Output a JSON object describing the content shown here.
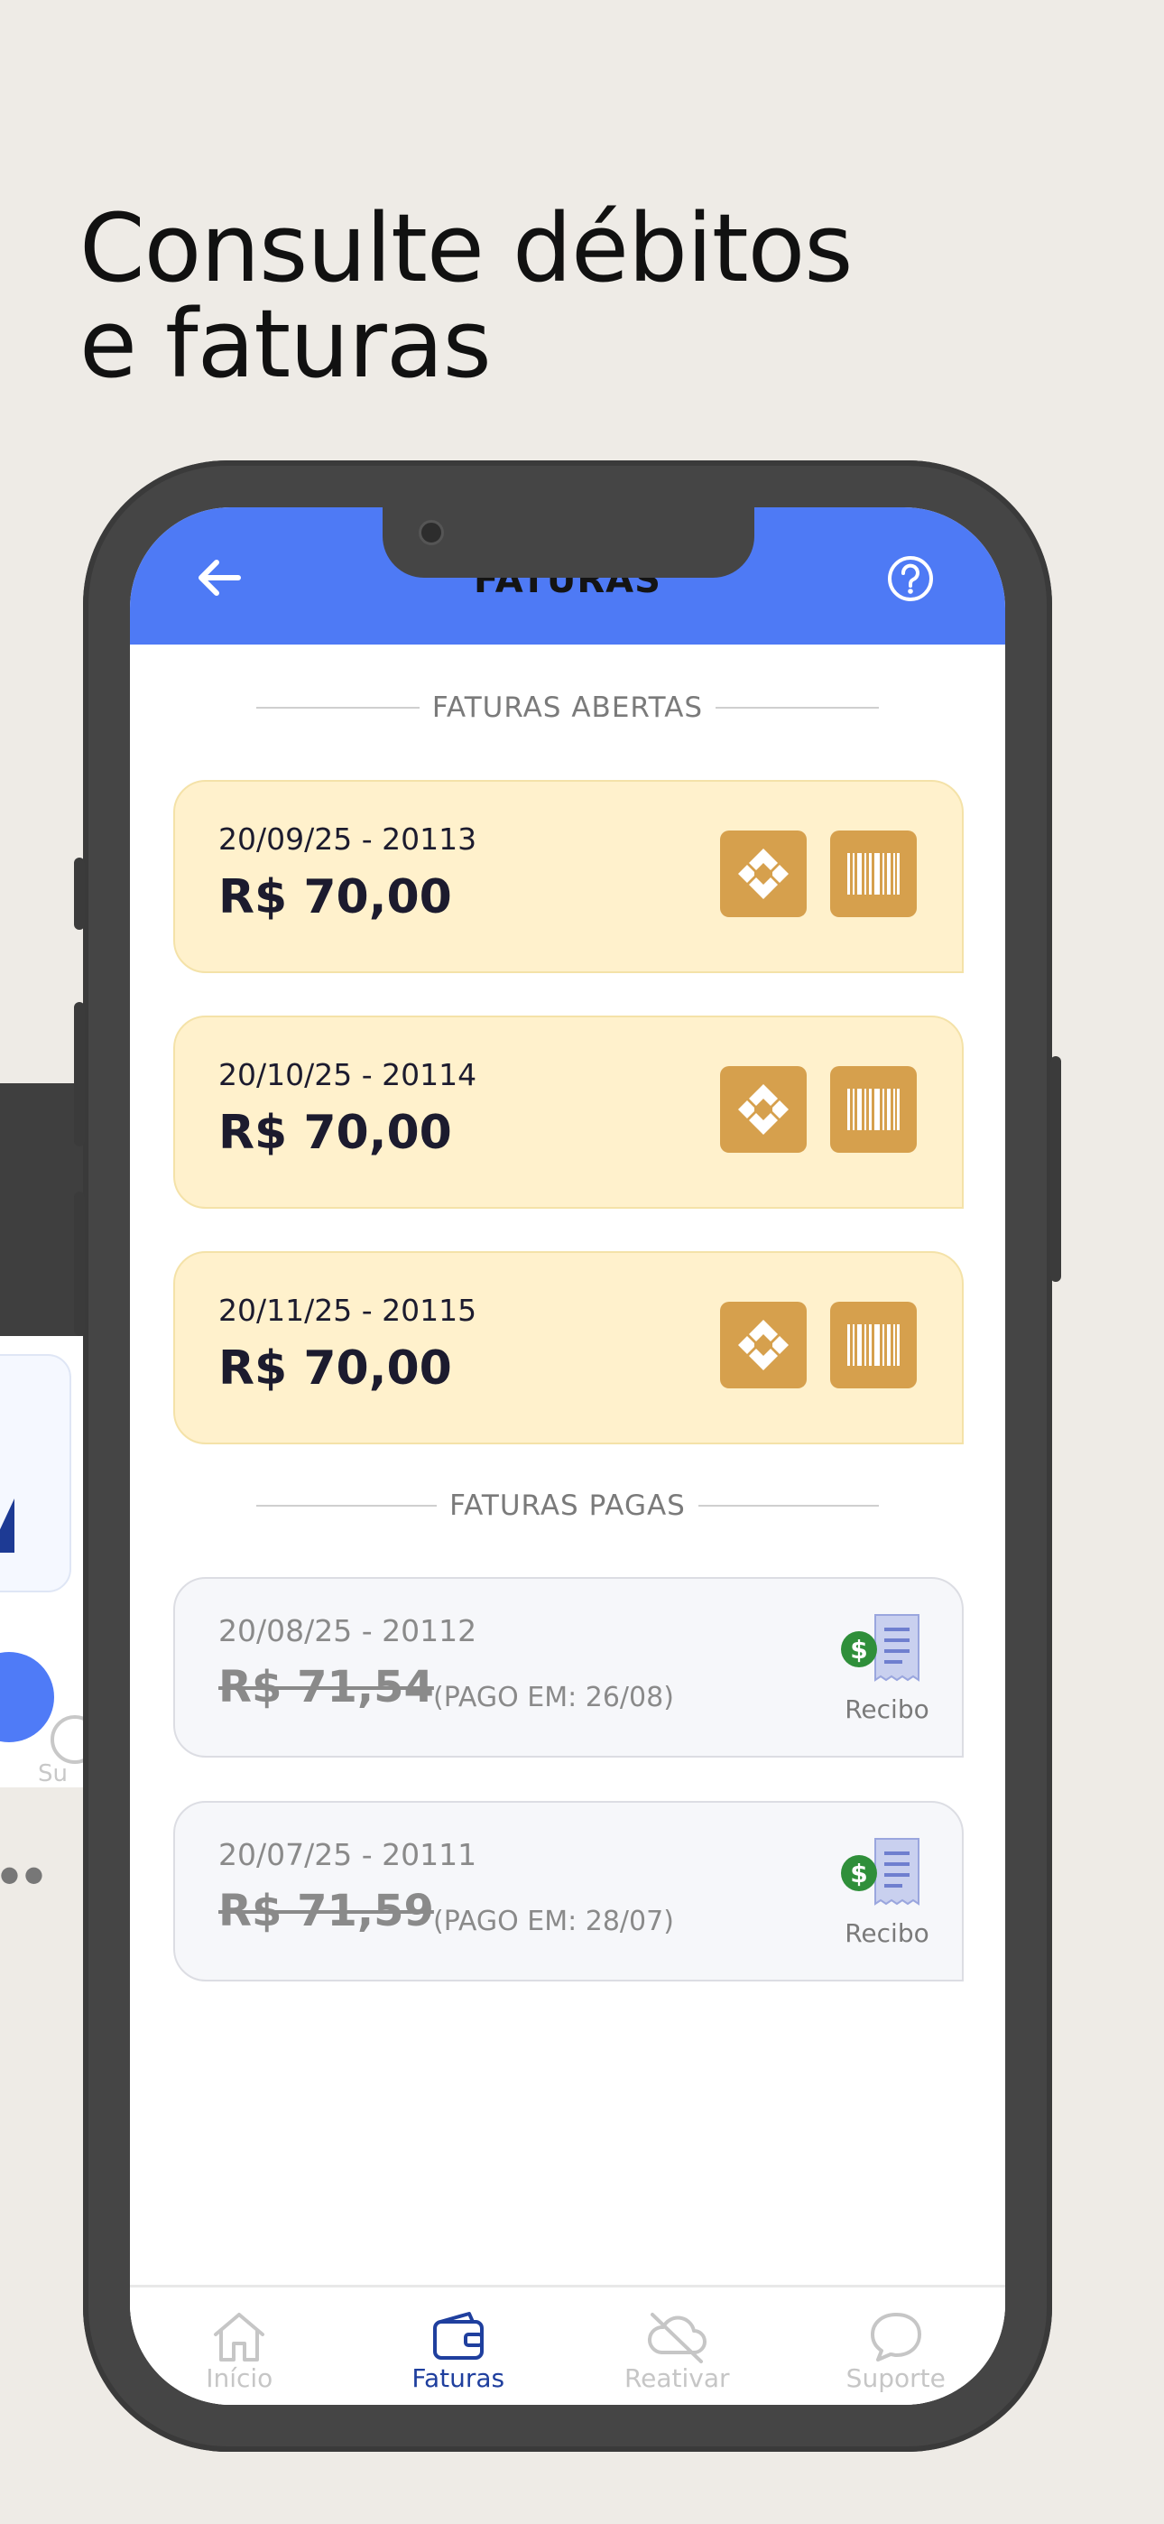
{
  "promo": {
    "headline_line1": "Consulte débitos",
    "headline_line2": "e faturas"
  },
  "background_phone": {
    "tab_label_partial": "Su"
  },
  "header": {
    "title": "FATURAS",
    "back_icon": "arrow-left-icon",
    "help_icon": "question-circle-icon",
    "color": "#4e7af5"
  },
  "open_section": {
    "label": "FATURAS ABERTAS",
    "items": [
      {
        "date_id": "20/09/25 - 20113",
        "amount": "R$ 70,00"
      },
      {
        "date_id": "20/10/25 - 20114",
        "amount": "R$ 70,00"
      },
      {
        "date_id": "20/11/25 - 20115",
        "amount": "R$ 70,00"
      }
    ],
    "pix_icon": "pix-icon",
    "barcode_icon": "barcode-icon",
    "card_color": "#fff1cc",
    "button_color": "#d6a04d"
  },
  "paid_section": {
    "label": "FATURAS PAGAS",
    "items": [
      {
        "date_id": "20/08/25 - 20112",
        "amount": "R$ 71,54",
        "paid_on": "(PAGO EM: 26/08)",
        "receipt_label": "Recibo"
      },
      {
        "date_id": "20/07/25 - 20111",
        "amount": "R$ 71,59",
        "paid_on": "(PAGO EM: 28/07)",
        "receipt_label": "Recibo"
      }
    ],
    "receipt_icon": "receipt-dollar-icon"
  },
  "tabbar": {
    "tabs": [
      {
        "label": "Início",
        "icon": "home-icon",
        "active": false
      },
      {
        "label": "Faturas",
        "icon": "wallet-icon",
        "active": true
      },
      {
        "label": "Reativar",
        "icon": "cloud-off-icon",
        "active": false
      },
      {
        "label": "Suporte",
        "icon": "chat-bubble-icon",
        "active": false
      }
    ],
    "active_color": "#1f3f9e"
  }
}
